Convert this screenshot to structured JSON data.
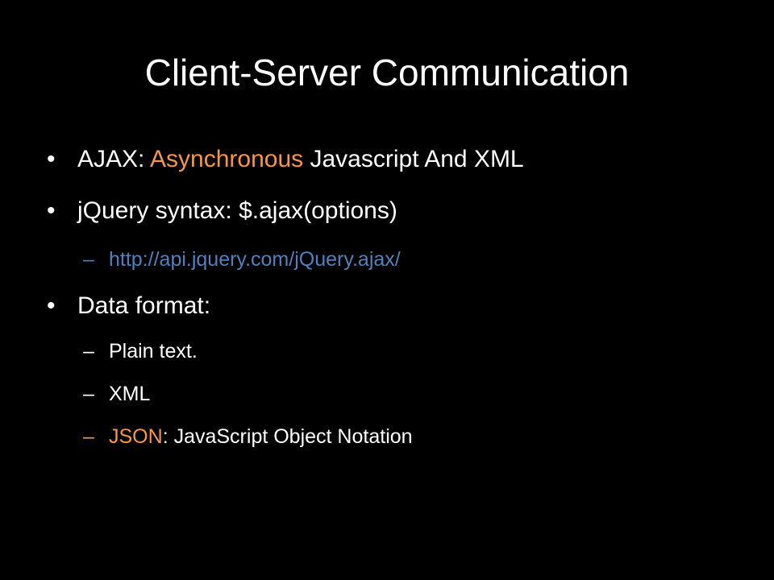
{
  "slide": {
    "title": "Client-Server Communication",
    "colors": {
      "background": "#000000",
      "text": "#ffffff",
      "accent": "#f79646",
      "link": "#4f81bd"
    },
    "bullet_symbol": "•",
    "dash_symbol": "–",
    "items": [
      {
        "level": 1,
        "prefix": "AJAX: ",
        "highlight": "Asynchronous",
        "suffix": " Javascript And XML"
      },
      {
        "level": 1,
        "text": "jQuery syntax: $.ajax(options)"
      },
      {
        "level": 2,
        "link_text": "http://api.jquery.com/jQuery.ajax/"
      },
      {
        "level": 1,
        "text": "Data format:"
      },
      {
        "level": 2,
        "text": "Plain text."
      },
      {
        "level": 2,
        "text": "XML"
      },
      {
        "level": 2,
        "highlight": "JSON",
        "suffix": ": JavaScript Object Notation"
      }
    ]
  }
}
